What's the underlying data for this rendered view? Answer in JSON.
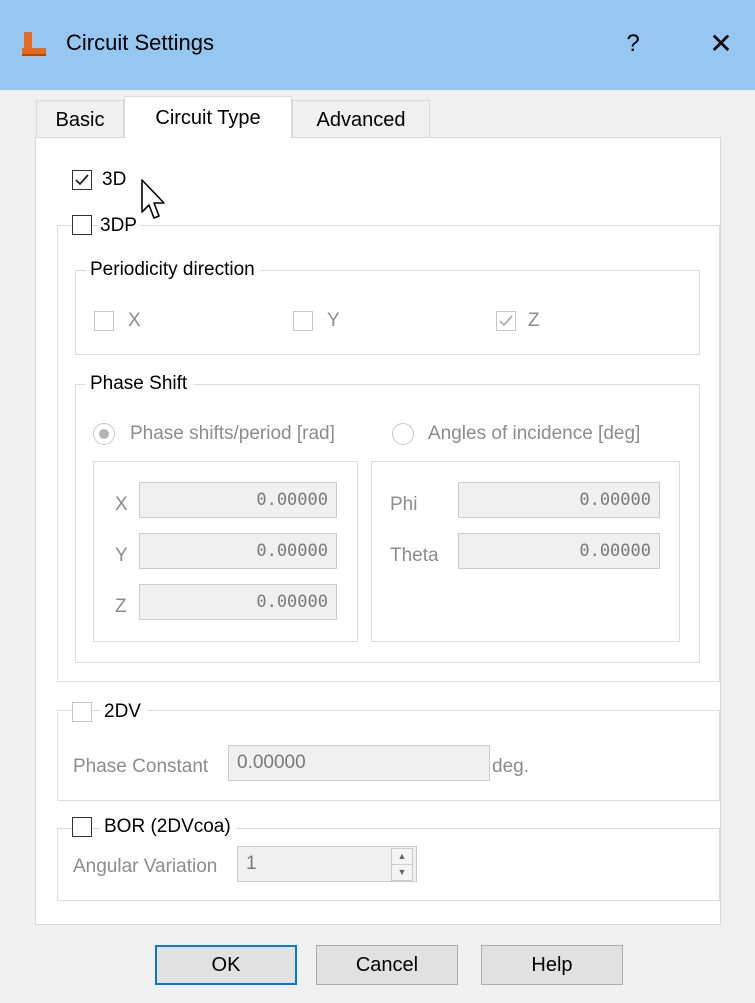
{
  "window": {
    "title": "Circuit Settings",
    "help_glyph": "?",
    "close_glyph": "✕"
  },
  "tabs": [
    {
      "label": "Basic"
    },
    {
      "label": "Circuit Type"
    },
    {
      "label": "Advanced"
    }
  ],
  "three_d": {
    "label": "3D",
    "checked": true
  },
  "three_dp": {
    "label": "3DP",
    "checked": false,
    "periodicity": {
      "title": "Periodicity direction",
      "x": {
        "label": "X",
        "checked": false
      },
      "y": {
        "label": "Y",
        "checked": false
      },
      "z": {
        "label": "Z",
        "checked": true
      }
    },
    "phase_shift": {
      "title": "Phase Shift",
      "radio_period": {
        "label": "Phase shifts/period [rad]",
        "selected": true
      },
      "radio_angles": {
        "label": "Angles of incidence [deg]",
        "selected": false
      },
      "x": {
        "label": "X",
        "value": "0.00000"
      },
      "y": {
        "label": "Y",
        "value": "0.00000"
      },
      "z": {
        "label": "Z",
        "value": "0.00000"
      },
      "phi": {
        "label": "Phi",
        "value": "0.00000"
      },
      "theta": {
        "label": "Theta",
        "value": "0.00000"
      }
    }
  },
  "two_dv": {
    "label": "2DV",
    "checked": false,
    "phase_constant_label": "Phase Constant",
    "phase_constant_value": "0.00000",
    "unit": "deg."
  },
  "bor": {
    "label": "BOR (2DVcoa)",
    "checked": false,
    "angular_label": "Angular Variation",
    "angular_value": "1",
    "spin_up": "▲",
    "spin_down": "▼"
  },
  "buttons": {
    "ok": "OK",
    "cancel": "Cancel",
    "help": "Help"
  },
  "colors": {
    "titlebar": "#95c7f0",
    "accent": "#0078d7",
    "disabled_text": "#8c8c8c",
    "icon_orange": "#e86a1f"
  }
}
